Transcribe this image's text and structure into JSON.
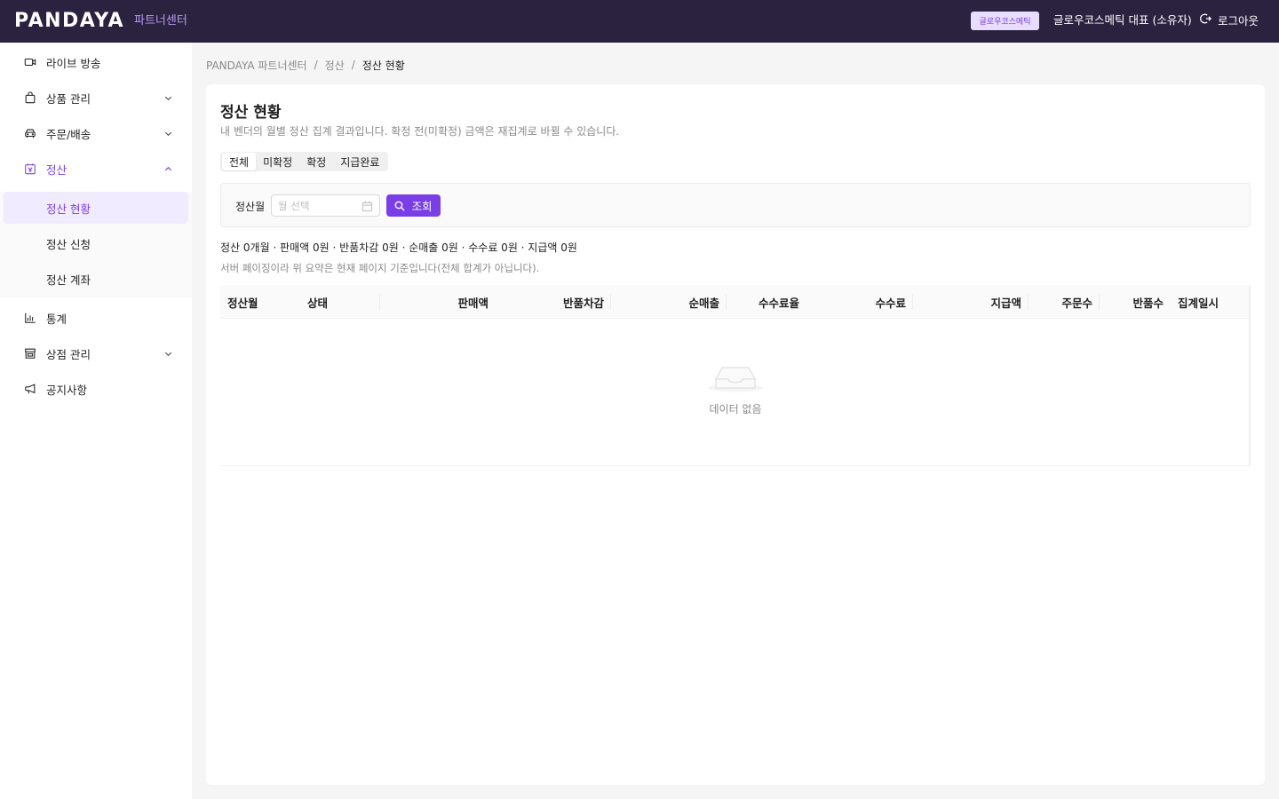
{
  "header": {
    "logo": "PANDAYA",
    "subtitle": "파트너센터",
    "vendor_badge": "글로우코스메틱",
    "user": "글로우코스메틱 대표 (소유자)",
    "logout": "로그아웃"
  },
  "sidebar": {
    "items": [
      {
        "label": "라이브 방송",
        "icon": "video-icon"
      },
      {
        "label": "상품 관리",
        "icon": "shopping-bag-icon",
        "expandable": true
      },
      {
        "label": "주문/배송",
        "icon": "car-icon",
        "expandable": true
      },
      {
        "label": "정산",
        "icon": "settlement-icon",
        "expanded": true
      },
      {
        "label": "통계",
        "icon": "bar-chart-icon"
      },
      {
        "label": "상점 관리",
        "icon": "store-icon",
        "expandable": true
      },
      {
        "label": "공지사항",
        "icon": "megaphone-icon"
      }
    ],
    "settlement_sub": [
      {
        "label": "정산 현황",
        "selected": true
      },
      {
        "label": "정산 신청"
      },
      {
        "label": "정산 계좌"
      }
    ]
  },
  "breadcrumb": [
    "PANDAYA 파트너센터",
    "정산",
    "정산 현황"
  ],
  "page": {
    "title": "정산 현황",
    "description": "내 벤더의 월별 정산 집계 결과입니다. 확정 전(미확정) 금액은 재집계로 바뀔 수 있습니다."
  },
  "tabs": [
    "전체",
    "미확정",
    "확정",
    "지급완료"
  ],
  "active_tab": "전체",
  "filter": {
    "label": "정산월",
    "placeholder": "월 선택",
    "search_label": "조회"
  },
  "summary": "정산 0개월 · 판매액 0원 · 반품차감 0원 · 순매출 0원 · 수수료 0원 · 지급액 0원",
  "note": "서버 페이징이라 위 요약은 현재 페이지 기준입니다(전체 합계가 아닙니다).",
  "table": {
    "columns": [
      "정산월",
      "상태",
      "판매액",
      "반품차감",
      "순매출",
      "수수료율",
      "수수료",
      "지급액",
      "주문수",
      "반품수",
      "집계일시"
    ],
    "rows": [],
    "empty_text": "데이터 없음"
  },
  "colors": {
    "header_bg": "#2b2240",
    "accent": "#7a3ee6",
    "badge_bg": "#e9ddff"
  }
}
